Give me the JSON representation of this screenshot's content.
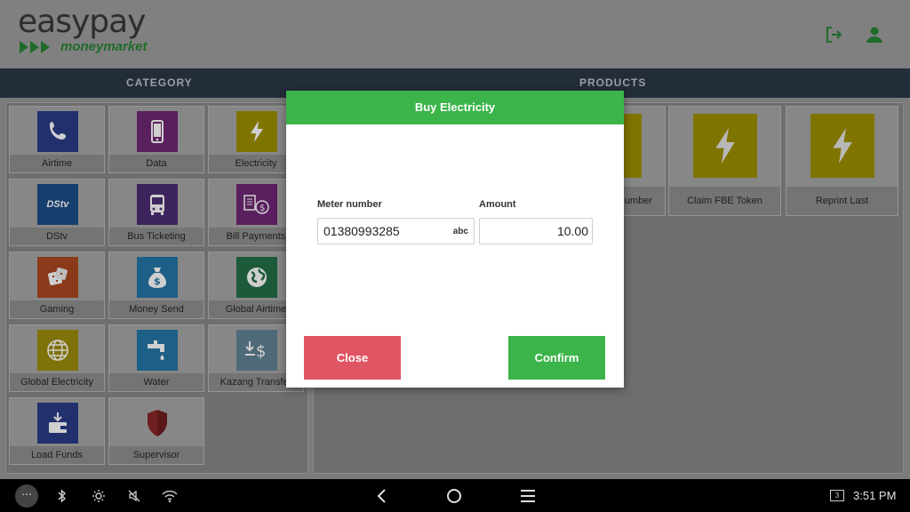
{
  "header": {
    "logo_main": "easypay",
    "logo_sub": "moneymarket",
    "icons": [
      "logout-icon",
      "user-icon"
    ]
  },
  "columns": {
    "category": "CATEGORY",
    "products": "PRODUCTS"
  },
  "categories": [
    {
      "label": "Airtime",
      "icon": "phone-icon",
      "color": "#22306e"
    },
    {
      "label": "Data",
      "icon": "mobile-icon",
      "color": "#5a1f5f"
    },
    {
      "label": "Electricity",
      "icon": "lightning-icon",
      "color": "#807400"
    },
    {
      "label": "DStv",
      "icon": "dstv-logo-icon",
      "color": "#163f6f"
    },
    {
      "label": "Bus Ticketing",
      "icon": "bus-icon",
      "color": "#3e245c"
    },
    {
      "label": "Bill Payments",
      "icon": "bill-payment-icon",
      "color": "#5a1f5f"
    },
    {
      "label": "Gaming",
      "icon": "dice-icon",
      "color": "#8a3a1a"
    },
    {
      "label": "Money Send",
      "icon": "money-bag-icon",
      "color": "#1d5f86"
    },
    {
      "label": "Global Airtime",
      "icon": "globe-icon",
      "color": "#1c5a3a"
    },
    {
      "label": "Global Electricity",
      "icon": "globe-grid-icon",
      "color": "#80720a"
    },
    {
      "label": "Water",
      "icon": "water-tap-icon",
      "color": "#1d5f86"
    },
    {
      "label": "Kazang Transfer",
      "icon": "transfer-icon",
      "color": "#4e6a78"
    },
    {
      "label": "Load Funds",
      "icon": "wallet-icon",
      "color": "#22306e"
    },
    {
      "label": "Supervisor",
      "icon": "shield-icon",
      "color": "#6e1f1f"
    }
  ],
  "products": [
    {
      "label": "umber",
      "icon": "lightning-icon"
    },
    {
      "label": "Claim FBE Token",
      "icon": "lightning-icon"
    },
    {
      "label": "Reprint Last",
      "icon": "lightning-icon"
    }
  ],
  "dialog": {
    "title": "Buy Electricity",
    "meter_label": "Meter number",
    "meter_value": "01380993285",
    "meter_keyboard": "abc",
    "amount_label": "Amount",
    "amount_value": "10.00",
    "close_label": "Close",
    "confirm_label": "Confirm",
    "colors": {
      "accent": "#3bb54a",
      "danger": "#e05563"
    }
  },
  "system_bar": {
    "more": "⋯",
    "screens": "3",
    "time": "3:51 PM",
    "icons": [
      "bluetooth-icon",
      "brightness-icon",
      "mute-icon",
      "wifi-icon",
      "back-icon",
      "home-icon",
      "menu-icon"
    ]
  }
}
